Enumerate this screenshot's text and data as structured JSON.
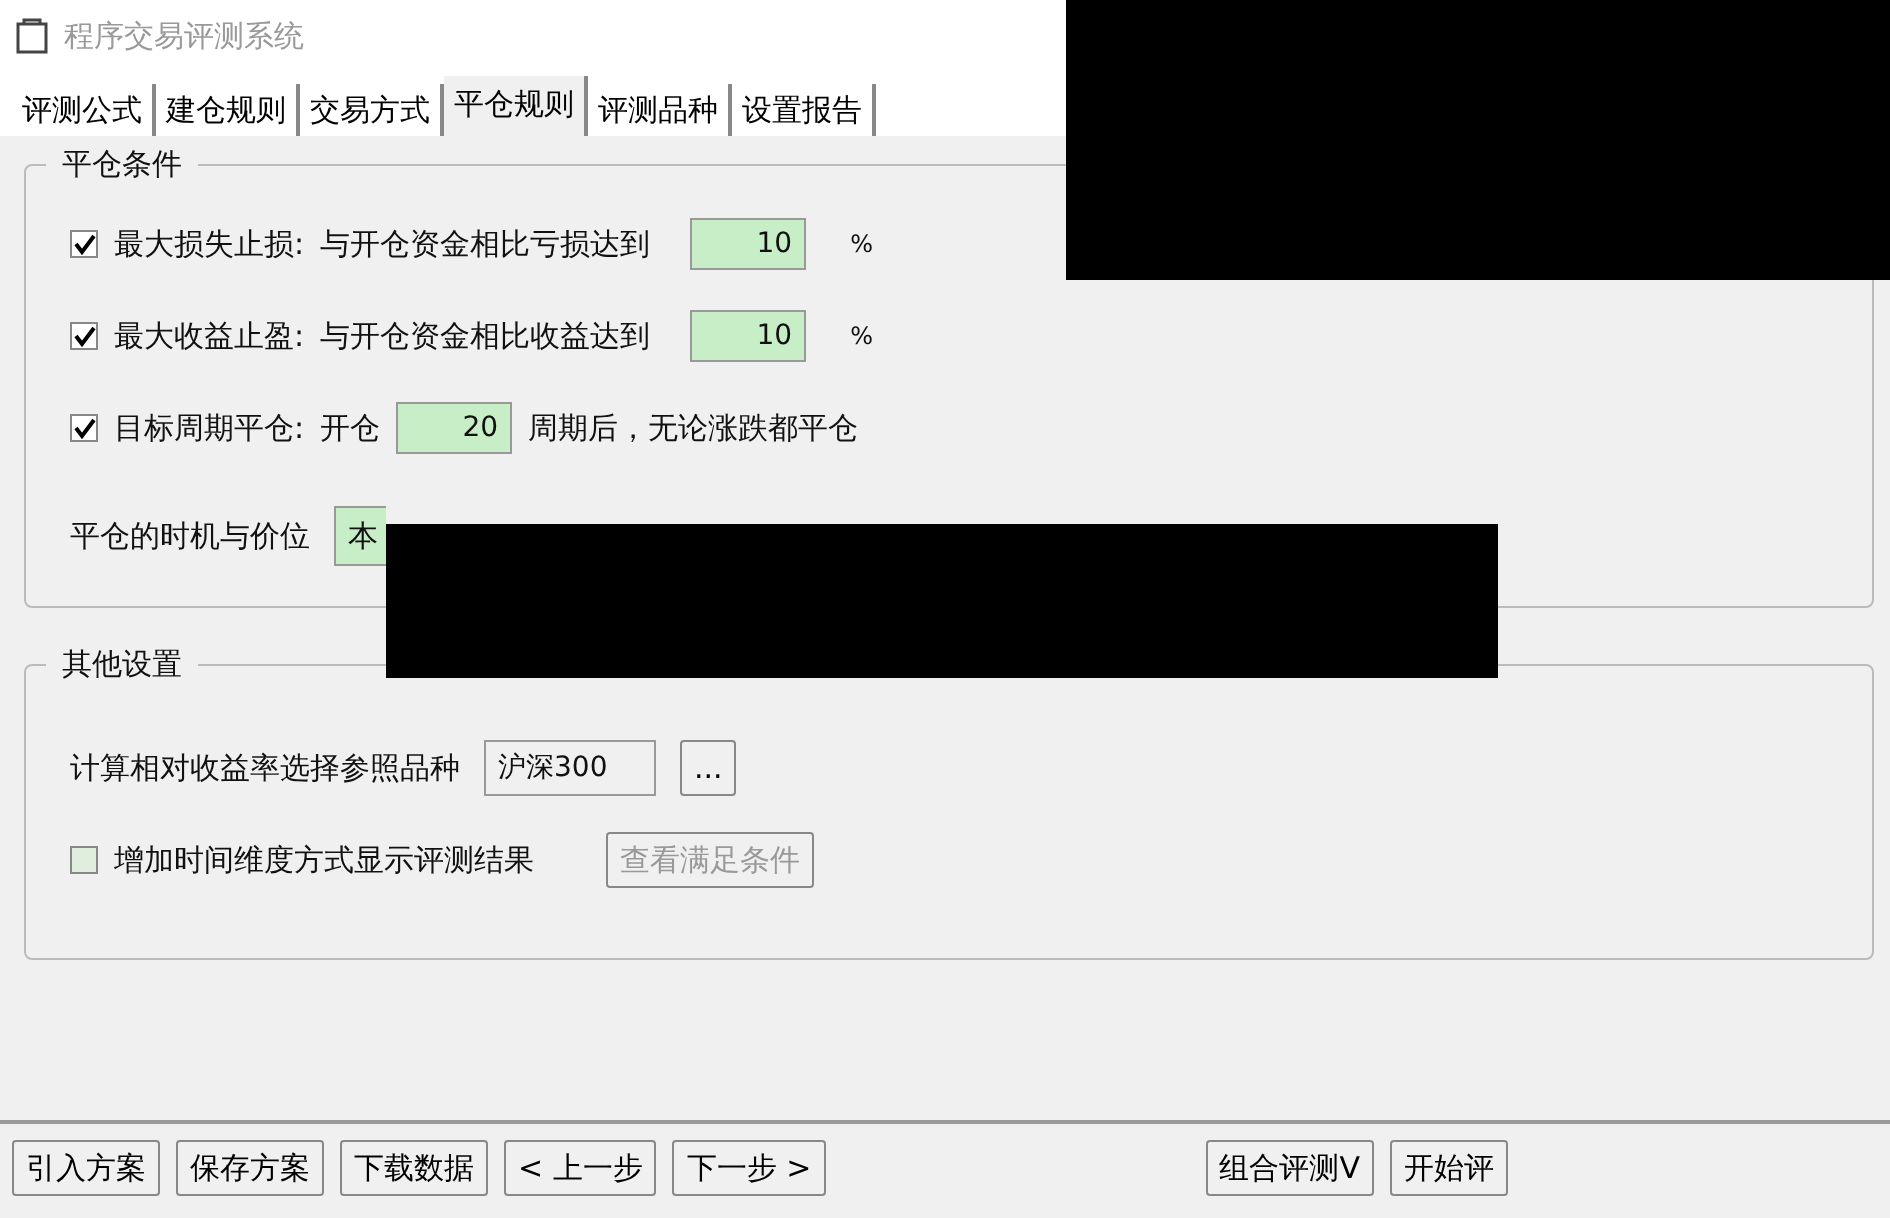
{
  "window": {
    "title": "程序交易评测系统"
  },
  "tabs": [
    {
      "label": "评测公式",
      "selected": false
    },
    {
      "label": "建仓规则",
      "selected": false
    },
    {
      "label": "交易方式",
      "selected": false
    },
    {
      "label": "平仓规则",
      "selected": true
    },
    {
      "label": "评测品种",
      "selected": false
    },
    {
      "label": "设置报告",
      "selected": false
    }
  ],
  "close_conditions": {
    "title": "平仓条件",
    "rows": [
      {
        "checked": true,
        "label": "最大损失止损:",
        "text": "与开仓资金相比亏损达到",
        "value": "10",
        "unit": "%"
      },
      {
        "checked": true,
        "label": "最大收益止盈:",
        "text": "与开仓资金相比收益达到",
        "value": "10",
        "unit": "%"
      },
      {
        "checked": true,
        "label": "目标周期平仓:",
        "text": "开仓",
        "value": "20",
        "unit": "周期后，无论涨跌都平仓"
      }
    ],
    "timing": {
      "label": "平仓的时机与价位",
      "value": "本"
    }
  },
  "other_settings": {
    "title": "其他设置",
    "reference": {
      "label": "计算相对收益率选择参照品种",
      "value": "沪深300",
      "button": "..."
    },
    "time_dimension": {
      "checked": false,
      "label": "增加时间维度方式显示评测结果",
      "button": "查看满足条件",
      "disabled": true
    }
  },
  "footer_buttons_left": [
    "引入方案",
    "保存方案",
    "下载数据",
    "< 上一步",
    "下一步 >"
  ],
  "footer_buttons_right": [
    "组合评测V",
    "开始评"
  ]
}
